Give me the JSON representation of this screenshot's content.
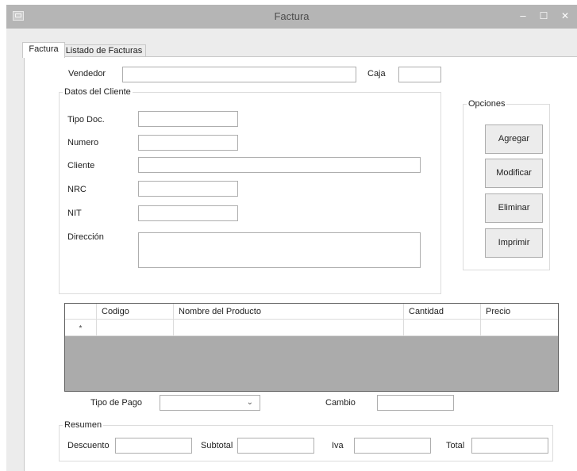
{
  "window": {
    "title": "Factura",
    "minimize_glyph": "–",
    "maximize_glyph": "☐",
    "close_glyph": "✕",
    "icon": "form-app-icon"
  },
  "tabs": [
    {
      "label": "Factura",
      "selected": true
    },
    {
      "label": "Listado de Facturas",
      "selected": false
    }
  ],
  "header": {
    "vendedor_label": "Vendedor",
    "vendedor_value": "",
    "caja_label": "Caja",
    "caja_value": ""
  },
  "cliente": {
    "group_label": "Datos del Cliente",
    "tipo_doc_label": "Tipo Doc.",
    "tipo_doc_value": "",
    "numero_label": "Numero",
    "numero_value": "",
    "cliente_label": "Cliente",
    "cliente_value": "",
    "nrc_label": "NRC",
    "nrc_value": "",
    "nit_label": "NIT",
    "nit_value": "",
    "direccion_label": "Dirección",
    "direccion_value": ""
  },
  "opciones": {
    "group_label": "Opciones",
    "agregar": "Agregar",
    "modificar": "Modificar",
    "eliminar": "Eliminar",
    "imprimir": "Imprimir"
  },
  "grid": {
    "columns": [
      "Codigo",
      "Nombre del Producto",
      "Cantidad",
      "Precio"
    ],
    "new_row_marker": "*"
  },
  "pago": {
    "tipo_pago_label": "Tipo de Pago",
    "tipo_pago_value": "",
    "cambio_label": "Cambio",
    "cambio_value": ""
  },
  "resumen": {
    "group_label": "Resumen",
    "descuento_label": "Descuento",
    "descuento_value": "",
    "subtotal_label": "Subtotal",
    "subtotal_value": "",
    "iva_label": "Iva",
    "iva_value": "",
    "total_label": "Total",
    "total_value": ""
  },
  "colors": {
    "titlebar": "#b5b5b5",
    "window_bg": "#ececec",
    "panel_bg": "#ffffff",
    "grid_empty_area": "#ababab"
  }
}
